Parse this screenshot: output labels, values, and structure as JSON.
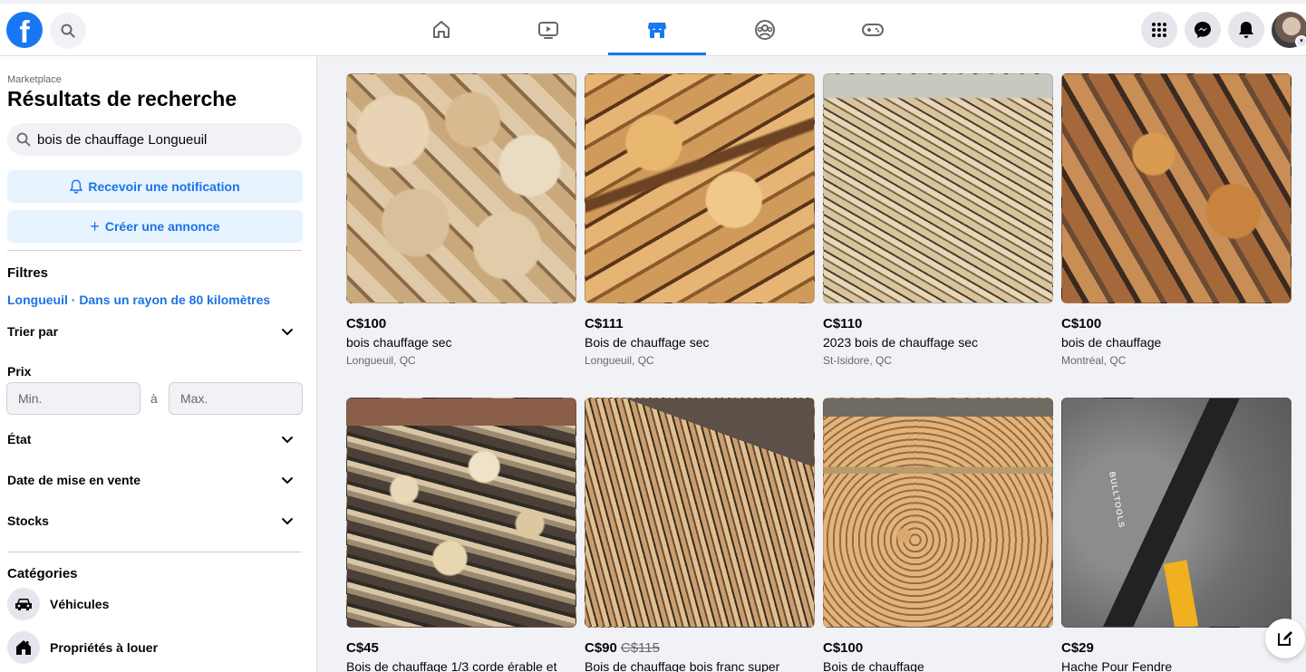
{
  "header": {
    "logo_letter": "f",
    "nav_tabs": [
      {
        "name": "home",
        "icon": "home-icon"
      },
      {
        "name": "watch",
        "icon": "video-icon"
      },
      {
        "name": "marketplace",
        "icon": "marketplace-icon",
        "active": true
      },
      {
        "name": "groups",
        "icon": "groups-icon"
      },
      {
        "name": "gaming",
        "icon": "gamepad-icon"
      }
    ],
    "right_icons": [
      "menu-grid-icon",
      "messenger-icon",
      "bell-icon",
      "avatar"
    ]
  },
  "sidebar": {
    "breadcrumb": "Marketplace",
    "title": "Résultats de recherche",
    "search_value": "bois de chauffage Longueuil",
    "notify_label": "Recevoir une notification",
    "create_label": "Créer une annonce",
    "filters_title": "Filtres",
    "location_text": "Longueuil · Dans un rayon de 80 kilomètres",
    "sort_label": "Trier par",
    "price_label": "Prix",
    "price_min_placeholder": "Min.",
    "price_sep": "à",
    "price_max_placeholder": "Max.",
    "condition_label": "État",
    "date_label": "Date de mise en vente",
    "stock_label": "Stocks",
    "categories_title": "Catégories",
    "categories": [
      {
        "label": "Véhicules",
        "icon": "car-icon"
      },
      {
        "label": "Propriétés à louer",
        "icon": "house-icon"
      }
    ]
  },
  "listings": [
    {
      "price": "C$100",
      "old_price": "",
      "title": "bois chauffage sec",
      "location": "Longueuil, QC"
    },
    {
      "price": "C$111",
      "old_price": "",
      "title": "Bois de chauffage sec",
      "location": "Longueuil, QC"
    },
    {
      "price": "C$110",
      "old_price": "",
      "title": "2023 bois de chauffage sec",
      "location": "St-Isidore, QC"
    },
    {
      "price": "C$100",
      "old_price": "",
      "title": "bois de chauffage",
      "location": "Montréal, QC"
    },
    {
      "price": "C$45",
      "old_price": "",
      "title": "Bois de chauffage 1/3 corde érable et",
      "location": ""
    },
    {
      "price": "C$90",
      "old_price": "C$115",
      "title": "Bois de chauffage bois franc super",
      "location": ""
    },
    {
      "price": "C$100",
      "old_price": "",
      "title": "Bois de chauffage",
      "location": ""
    },
    {
      "price": "C$29",
      "old_price": "",
      "title": "Hache Pour Fendre",
      "location": ""
    }
  ],
  "axe_brand": "BULLTOOLS",
  "colors": {
    "accent": "#1877f2",
    "link": "#1b74e4",
    "background": "#f0f2f5"
  }
}
